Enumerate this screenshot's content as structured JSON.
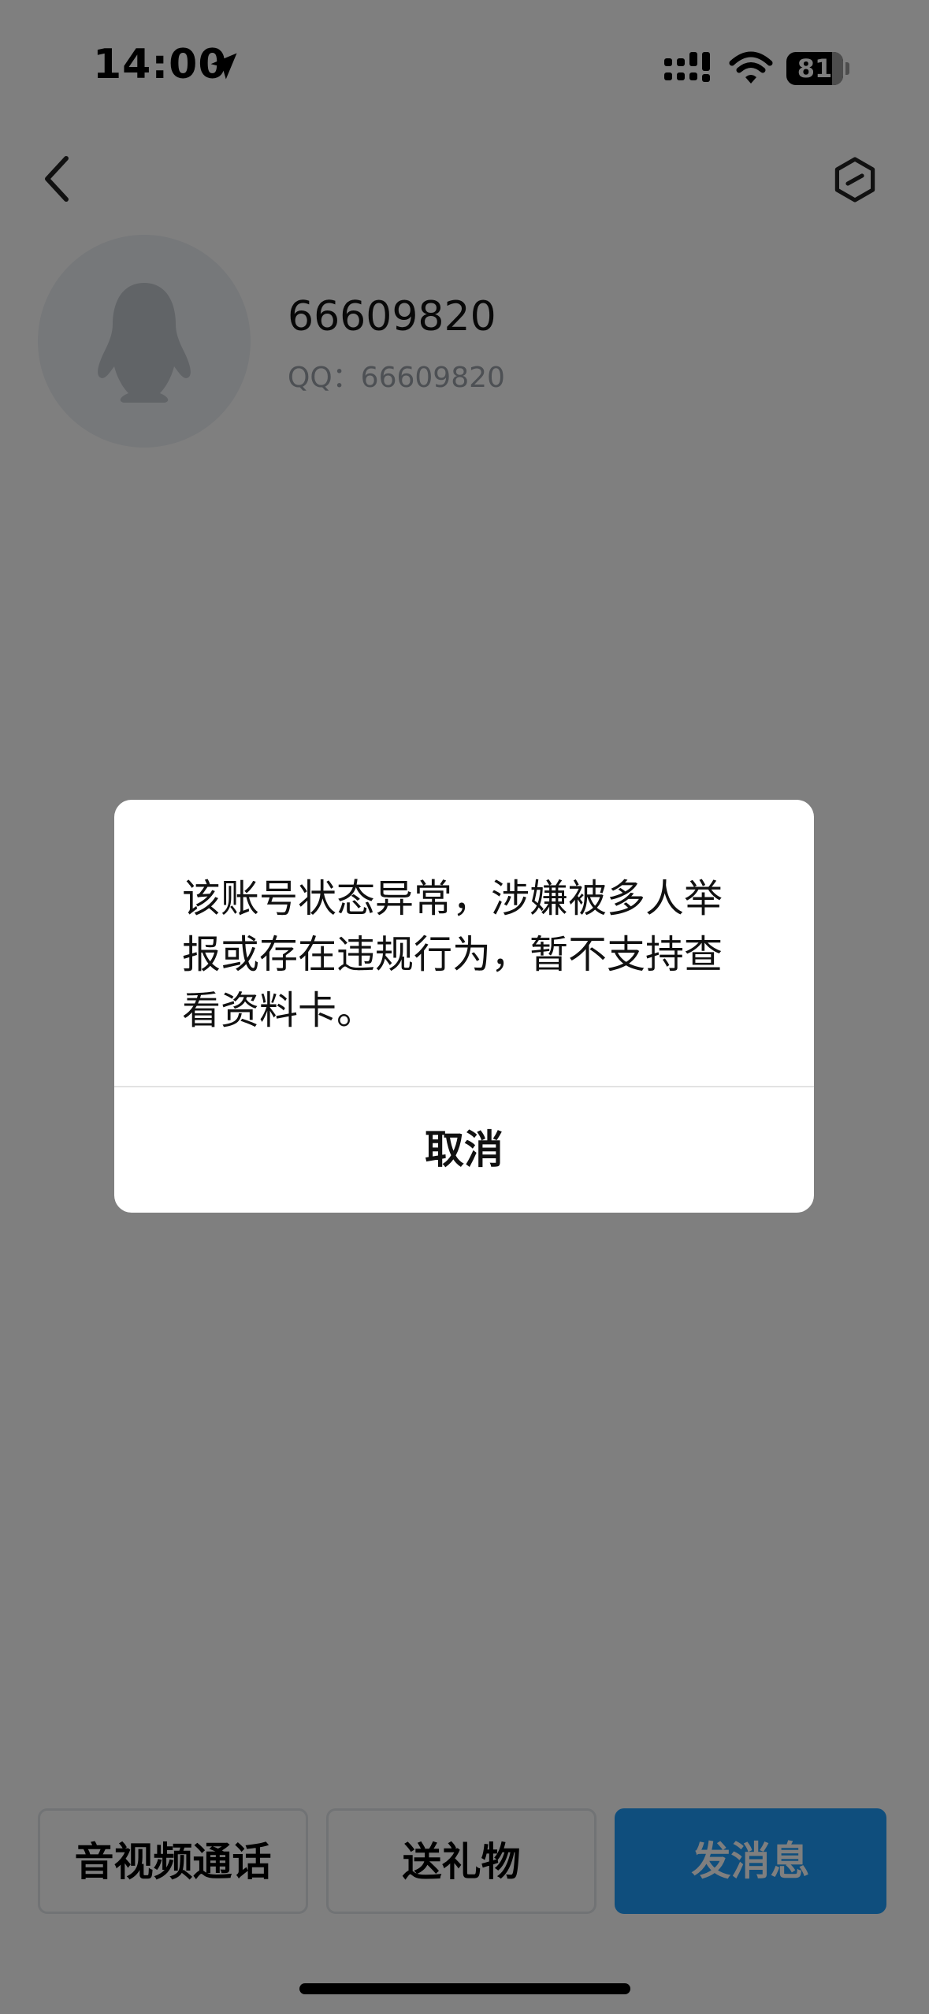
{
  "status_bar": {
    "time": "14:00",
    "battery_level": "81",
    "icons": [
      "location-arrow-icon",
      "cellular-signal-icon",
      "wifi-icon",
      "battery-icon"
    ]
  },
  "nav": {
    "back_icon": "chevron-left-icon",
    "settings_icon": "hexagon-settings-icon"
  },
  "profile": {
    "name": "66609820",
    "qq_label": "QQ：66609820",
    "avatar_icon": "penguin-icon"
  },
  "actions": {
    "call_label": "音视频通话",
    "gift_label": "送礼物",
    "message_label": "发消息"
  },
  "dialog": {
    "message": "该账号状态异常，涉嫌被多人举报或存在违规行为，暂不支持查看资料卡。",
    "cancel_label": "取消"
  },
  "colors": {
    "primary": "#1e9dfb",
    "overlay": "rgba(0,0,0,0.5)",
    "subtle_text": "#9aa0a8"
  }
}
